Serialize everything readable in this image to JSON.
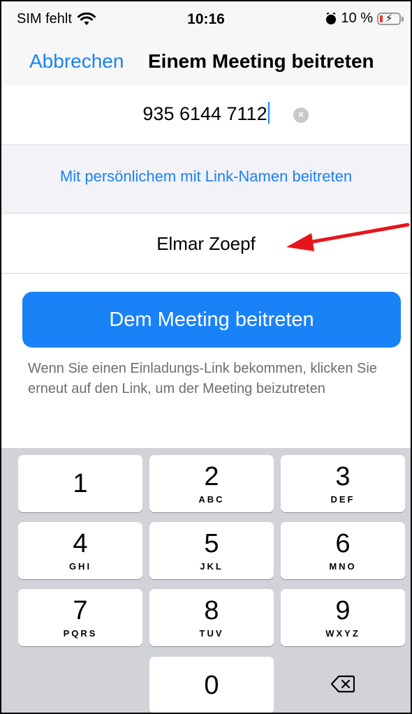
{
  "status_bar": {
    "carrier": "SIM fehlt",
    "time": "10:16",
    "battery_percent": "10 %",
    "icons": [
      "wifi-icon",
      "alarm-icon",
      "battery-charging-icon"
    ]
  },
  "nav": {
    "cancel_label": "Abbrechen",
    "title": "Einem Meeting beitreten"
  },
  "meeting_id_field": {
    "value": "935 6144 7112"
  },
  "personal_link_label": "Mit persönlichem mit Link-Namen beitreten",
  "name_field": {
    "value": "Elmar Zoepf"
  },
  "join_button_label": "Dem Meeting beitreten",
  "hint_text": "Wenn Sie einen Einladungs-Link bekommen, klicken Sie erneut auf den Link, um der Meeting beizutreten",
  "colors": {
    "accent": "#1a82f7",
    "annotation_arrow": "#e8141c"
  },
  "keypad": {
    "keys": [
      {
        "num": "1",
        "letters": ""
      },
      {
        "num": "2",
        "letters": "ABC"
      },
      {
        "num": "3",
        "letters": "DEF"
      },
      {
        "num": "4",
        "letters": "GHI"
      },
      {
        "num": "5",
        "letters": "JKL"
      },
      {
        "num": "6",
        "letters": "MNO"
      },
      {
        "num": "7",
        "letters": "PQRS"
      },
      {
        "num": "8",
        "letters": "TUV"
      },
      {
        "num": "9",
        "letters": "WXYZ"
      },
      {
        "num": "0",
        "letters": ""
      }
    ],
    "delete_icon": "backspace-icon"
  }
}
